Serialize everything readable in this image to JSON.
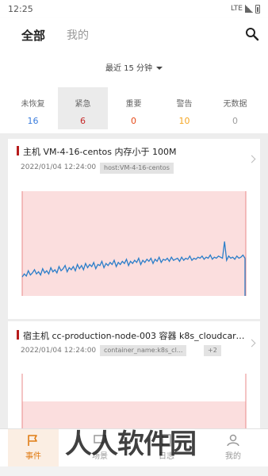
{
  "status_bar": {
    "time": "12:25",
    "network": "LTE"
  },
  "header": {
    "tabs": [
      {
        "label": "全部",
        "active": true
      },
      {
        "label": "我的",
        "active": false
      }
    ],
    "search_icon": "search-icon",
    "time_range": "最近 15 分钟"
  },
  "summary": [
    {
      "label": "未恢复",
      "count": "16",
      "color": "#3b7ddd",
      "active": false
    },
    {
      "label": "紧急",
      "count": "6",
      "color": "#c62828",
      "active": true
    },
    {
      "label": "重要",
      "count": "0",
      "color": "#e64a19",
      "active": false
    },
    {
      "label": "警告",
      "count": "10",
      "color": "#f5a623",
      "active": false
    },
    {
      "label": "无数据",
      "count": "0",
      "color": "#9e9e9e",
      "active": false
    }
  ],
  "events": [
    {
      "title": "主机 VM-4-16-centos 内存小于 100M",
      "time": "2022/01/04 12:24:00",
      "tags": [
        "host:VM-4-16-centos"
      ],
      "severity_color": "#b71c1c",
      "series": [
        1.8,
        2.1,
        1.9,
        2.4,
        2.0,
        2.2,
        2.5,
        2.1,
        2.3,
        2.0,
        2.6,
        2.2,
        2.4,
        2.1,
        2.7,
        2.3,
        2.5,
        2.2,
        2.8,
        2.4,
        2.6,
        2.9,
        2.3,
        2.7,
        2.5,
        2.8,
        2.4,
        3.0,
        2.6,
        2.9,
        2.5,
        3.1,
        2.7,
        3.0,
        2.8,
        3.2,
        2.6,
        3.0,
        2.9,
        3.3,
        2.7,
        3.1,
        2.9,
        3.2,
        3.0,
        3.4,
        2.8,
        3.2,
        3.0,
        3.3,
        3.1,
        3.5,
        2.9,
        3.3,
        3.1,
        3.4,
        3.2,
        3.6,
        3.0,
        3.4,
        3.2,
        3.5,
        3.3,
        3.6,
        3.1,
        3.5,
        3.3,
        3.7,
        3.2,
        3.5,
        3.4,
        3.6,
        3.3,
        3.7,
        3.4,
        3.5,
        3.6,
        3.3,
        3.7,
        3.4,
        3.6,
        3.5,
        3.8,
        3.4,
        3.6,
        3.5,
        3.7,
        3.6,
        3.8,
        3.5,
        3.7,
        3.6,
        3.9,
        3.5,
        3.7,
        3.6,
        3.8,
        3.7,
        3.6,
        5.2,
        3.4,
        3.8,
        3.6,
        3.7,
        3.5,
        3.8,
        3.6,
        3.7,
        3.9,
        3.6
      ],
      "ylim": [
        0,
        10
      ]
    },
    {
      "title": "宿主机 cc-production-node-003 容器 k8s_cloudcare-...",
      "time": "2022/01/04 12:24:00",
      "tags": [
        "container_name:k8s_cl...",
        "+2"
      ],
      "severity_color": "#b71c1c"
    }
  ],
  "bottom_nav": [
    {
      "label": "事件",
      "active": true
    },
    {
      "label": "场景",
      "active": false
    },
    {
      "label": "日志",
      "active": false
    },
    {
      "label": "我的",
      "active": false
    }
  ],
  "watermark": "人人软件园",
  "colors": {
    "accent": "#e07b13",
    "alert_fill": "#fbdede",
    "alert_border": "#e88a8a",
    "series": "#2b7ec9"
  }
}
